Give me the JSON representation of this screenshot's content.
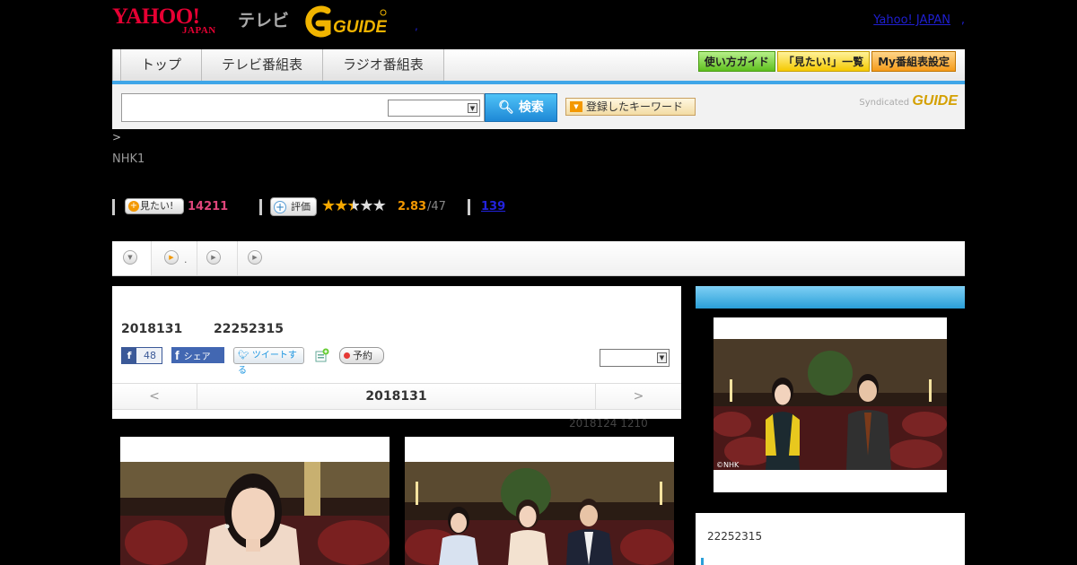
{
  "header": {
    "yahoo_logo": "YAHOO!",
    "yahoo_logo_sub": "JAPAN",
    "tv_label": "テレビ",
    "gguide_logo": "G GUIDE",
    "yahoo_japan_link": "Yahoo! JAPAN",
    "right_dot": ",",
    "center_dot": ","
  },
  "nav": {
    "tabs": [
      {
        "label": "トップ"
      },
      {
        "label": "テレビ番組表"
      },
      {
        "label": "ラジオ番組表"
      }
    ],
    "guide_button": "使い方ガイド",
    "mitai_list_button": "「見たい!」一覧",
    "my_guide_button": "My番組表設定",
    "colors": {
      "accent_blue": "#3fa6e8",
      "green_button": "#5fbf1e",
      "orange_button": "#f59b1a"
    }
  },
  "search": {
    "input_value": "",
    "select_value": "",
    "button_label": "検索",
    "keyword_button": "登録したキーワード",
    "syndicated_label": "Syndicated",
    "syndicated_logo": "GUIDE"
  },
  "program": {
    "breadcrumb": ">",
    "channel": "NHK1",
    "mitai_button": "見たい!",
    "mitai_count": "14211",
    "rating_button": "評価",
    "rating_value": "2.83",
    "rating_total": "/47",
    "stars_filled": 2.5,
    "reviews_count": "139"
  },
  "main": {
    "date": "2018131",
    "time": "22252315",
    "fb_count": "48",
    "fb_share_label": "シェア",
    "tweet_label": "ツイートする",
    "reserve_label": "予約",
    "dropdown_value": "",
    "prev_label": "<",
    "current_date": "2018131",
    "next_label": ">",
    "updated": "2018124  1210"
  },
  "thumbnails": [
    {
      "name": "cast-portrait"
    },
    {
      "name": "cast-group"
    }
  ],
  "sidebar": {
    "time": "22252315",
    "copyright": "©NHK"
  }
}
